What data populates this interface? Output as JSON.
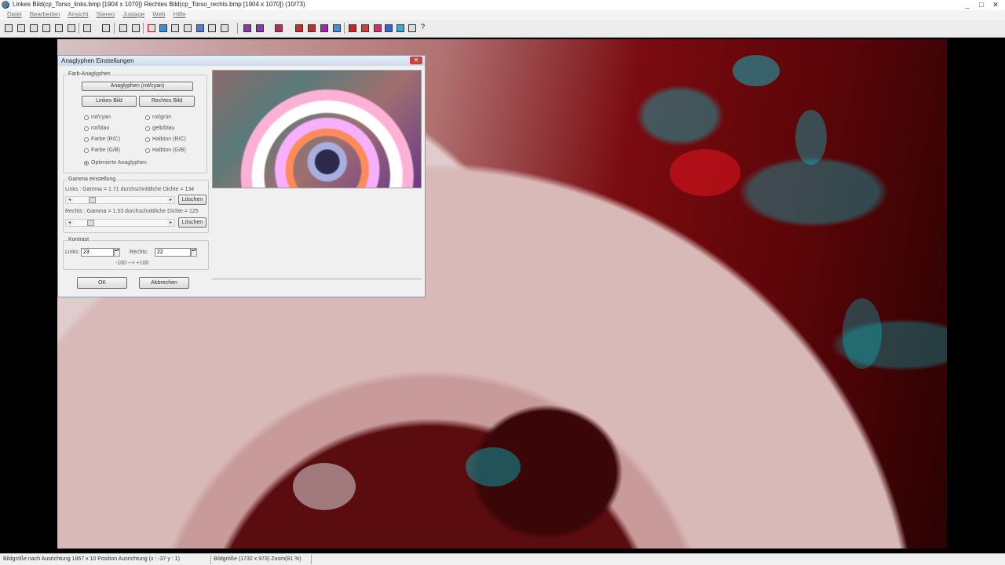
{
  "window": {
    "title": "Linkes Bild(cp_Torso_links.bmp [1904 x 1070]) Rechtes Bild(cp_Torso_rechts.bmp [1904 x 1070]) (10/73)",
    "controls": [
      "_",
      "□",
      "✕"
    ]
  },
  "menu": [
    "Datei",
    "Bearbeiten",
    "Ansicht",
    "Stereo",
    "Justage",
    "Web",
    "Hilfe"
  ],
  "dialog": {
    "title": "Anaglyphen Einstellungen",
    "close": "✕",
    "color_group": {
      "legend": "Farb-Anaglyphen",
      "main_button": "Anaglyphen (rot/cyan)",
      "left_button": "Linkes Bild",
      "right_button": "Rechtes Bild",
      "options": [
        {
          "label": "rot/cyan",
          "selected": false
        },
        {
          "label": "rot/grün",
          "selected": false
        },
        {
          "label": "rot/blau",
          "selected": false
        },
        {
          "label": "gelb/blau",
          "selected": false
        },
        {
          "label": "Farbe (R/C)",
          "selected": false
        },
        {
          "label": "Halbton (R/C)",
          "selected": false
        },
        {
          "label": "Farbe (G/B)",
          "selected": false
        },
        {
          "label": "Halbton (G/B)",
          "selected": false
        },
        {
          "label": "Optimierte Anaglyphen",
          "selected": true
        }
      ]
    },
    "gamma_group": {
      "legend": "Gamma einstellung",
      "left_label": "Links : Gamma = 1.71 durchschnittliche Dichte = 134",
      "right_label": "Rechts : Gamma = 1.53 durchschnittliche Dichte = 125",
      "reset": "Löschen",
      "left_level": 0.18,
      "right_level": 0.16
    },
    "contrast_group": {
      "legend": "Kontrast",
      "left_label": "Links:",
      "left_value": "23",
      "right_label": "Rechts:",
      "right_value": "22",
      "range_hint": "-100 --> +100"
    },
    "ok": "OK",
    "cancel": "Abbrechen"
  },
  "status": {
    "align": "Bildgröße nach Ausrichtung 1867 x 10 Position Ausrichtung (x : -37 y : 1)",
    "size": "Bildgröße (1732 x 973) Zoom(81 %)"
  }
}
